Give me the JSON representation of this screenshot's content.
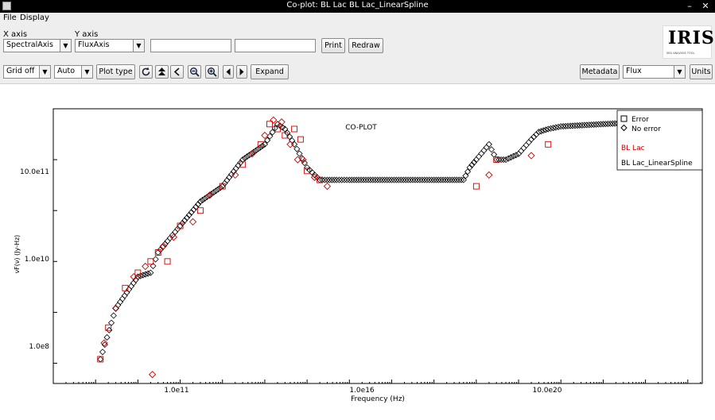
{
  "window": {
    "title": "Co-plot:  BL Lac BL Lac_LinearSpline",
    "close_glyph": "✕",
    "minimize_glyph": "–"
  },
  "menu": [
    "File",
    "Display"
  ],
  "axes_controls": {
    "x_label": "X axis",
    "x_value": "SpectralAxis",
    "y_label": "Y axis",
    "y_value": "FluxAxis",
    "field1_value": "",
    "field2_value": ""
  },
  "buttons": {
    "print": "Print",
    "redraw": "Redraw",
    "plot_type": "Plot type",
    "expand": "Expand",
    "metadata": "Metadata",
    "units": "Units"
  },
  "grid_select": "Grid off",
  "auto_select": "Auto",
  "flux_select": "Flux",
  "logo": {
    "text": "IRIS",
    "subtitle": "SED ANALYSIS TOOL"
  },
  "chart_data": {
    "type": "scatter",
    "title": "CO-PLOT",
    "xlabel": "Frequency (Hz)",
    "ylabel": "νF(ν) (Jy-Hz)",
    "xscale": "log",
    "yscale": "log",
    "xlim": [
      100000000.0,
      2.2e+23
    ],
    "ylim": [
      40000000.0,
      10000000000000.0
    ],
    "x_ticks": [
      "1.0e11",
      "1.0e16",
      "10.0e20"
    ],
    "y_ticks": [
      "1.0e8",
      "1.0e10",
      "10.0e11"
    ],
    "grid": false,
    "legend": {
      "position": "top-right",
      "items": [
        {
          "label": "Error",
          "marker": "square",
          "color": "#000000"
        },
        {
          "label": "No error",
          "marker": "diamond",
          "color": "#000000"
        },
        {
          "label": "BL Lac",
          "marker": "none",
          "color": "#cc0000"
        },
        {
          "label": "BL Lac_LinearSpline",
          "marker": "none",
          "color": "#000000"
        }
      ]
    },
    "series": [
      {
        "name": "BL Lac",
        "color": "#cc0000",
        "x": [
          1300000000.0,
          1600000000.0,
          2000000000.0,
          3000000000.0,
          5000000000.0,
          8000000000.0,
          10000000000.0,
          15000000000.0,
          20000000000.0,
          22000000000.0,
          30000000000.0,
          40000000000.0,
          50000000000.0,
          70000000000.0,
          100000000000.0,
          200000000000.0,
          300000000000.0,
          500000000000.0,
          1000000000000.0,
          2000000000000.0,
          3000000000000.0,
          5000000000000.0,
          8000000000000.0,
          10000000000000.0,
          13000000000000.0,
          16000000000000.0,
          20000000000000.0,
          25000000000000.0,
          30000000000000.0,
          40000000000000.0,
          50000000000000.0,
          60000000000000.0,
          70000000000000.0,
          80000000000000.0,
          100000000000000.0,
          150000000000000.0,
          200000000000000.0,
          300000000000000.0,
          1e+18,
          2e+18,
          3e+18,
          2e+19,
          5e+19
        ],
        "y": [
          120000000.0,
          250000000.0,
          500000000.0,
          1200000000.0,
          3000000000.0,
          5000000000.0,
          6000000000.0,
          8000000000.0,
          10000000000.0,
          60000000.0,
          15000000000.0,
          20000000000.0,
          10000000000.0,
          30000000000.0,
          50000000000.0,
          60000000000.0,
          100000000000.0,
          200000000000.0,
          300000000000.0,
          500000000000.0,
          800000000000.0,
          1300000000000.0,
          2000000000000.0,
          3000000000000.0,
          5000000000000.0,
          6000000000000.0,
          4000000000000.0,
          5500000000000.0,
          3000000000000.0,
          2000000000000.0,
          4000000000000.0,
          1000000000000.0,
          2500000000000.0,
          1000000000000.0,
          600000000000.0,
          450000000000.0,
          400000000000.0,
          300000000000.0,
          300000000000.0,
          500000000000.0,
          1000000000000.0,
          1200000000000.0,
          2000000000000.0
        ]
      },
      {
        "name": "BL Lac_LinearSpline",
        "color": "#000000",
        "x": [
          1300000000.0,
          3000000000.0,
          10000000000.0,
          20000000000.0,
          30000000000.0,
          50000000000.0,
          100000000000.0,
          300000000000.0,
          1000000000000.0,
          3000000000000.0,
          10000000000000.0,
          20000000000000.0,
          30000000000000.0,
          50000000000000.0,
          100000000000000.0,
          200000000000000.0,
          300000000000000.0,
          500000000000000.0,
          1000000000000000.0,
          1e+16,
          1e+17,
          5e+17,
          7e+17,
          1e+18,
          2e+18,
          3e+18,
          5e+18,
          1e+19,
          2e+19,
          3e+19,
          5e+19,
          1e+20,
          1e+21,
          1e+22,
          1e+23,
          1.5e+23
        ],
        "y": [
          120000000.0,
          1200000000.0,
          5000000000.0,
          6000000000.0,
          15000000000.0,
          25000000000.0,
          50000000000.0,
          150000000000.0,
          300000000000.0,
          1000000000000.0,
          2000000000000.0,
          5000000000000.0,
          4000000000000.0,
          2000000000000.0,
          700000000000.0,
          400000000000.0,
          400000000000.0,
          400000000000.0,
          400000000000.0,
          400000000000.0,
          400000000000.0,
          400000000000.0,
          700000000000.0,
          1000000000000.0,
          2000000000000.0,
          1000000000000.0,
          1000000000000.0,
          1300000000000.0,
          2500000000000.0,
          3500000000000.0,
          4000000000000.0,
          4500000000000.0,
          5000000000000.0,
          5500000000000.0,
          6000000000000.0,
          6500000000000.0
        ]
      }
    ]
  }
}
